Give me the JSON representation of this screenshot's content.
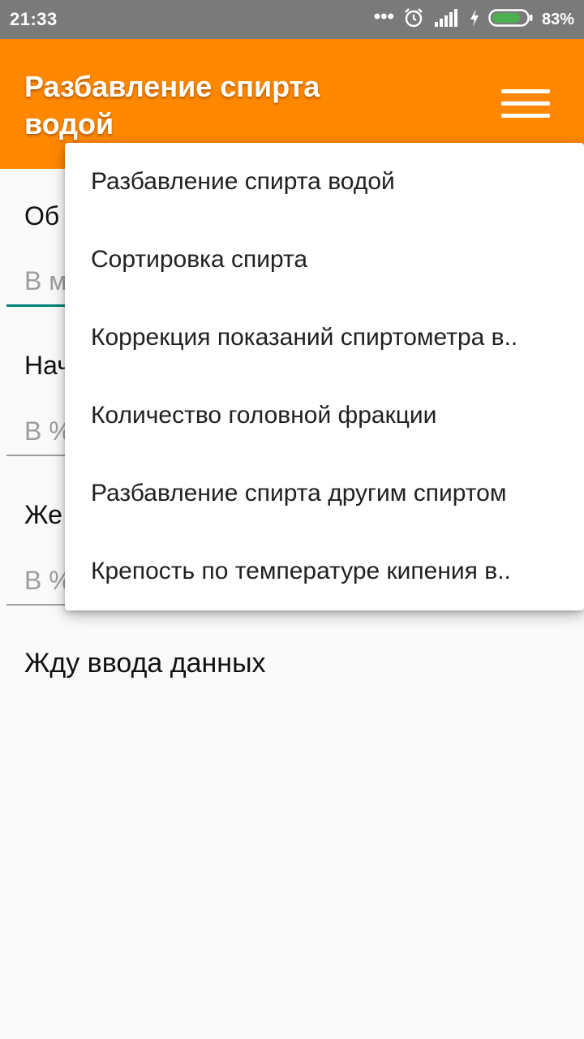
{
  "status_bar": {
    "time": "21:33",
    "battery_percent": "83%",
    "battery_level": 0.83,
    "battery_color": "#4caf50",
    "icons": [
      "more-dots-icon",
      "alarm-icon",
      "signal-icon",
      "charging-icon",
      "battery-icon"
    ]
  },
  "app_bar": {
    "title": "Разбавление спирта водой",
    "color": "#ff8800",
    "menu_icon": "hamburger-menu-icon"
  },
  "form": {
    "fields": [
      {
        "label": "Об",
        "placeholder": "В м"
      },
      {
        "label": "Нач",
        "placeholder": "В %"
      },
      {
        "label": "Же",
        "placeholder": "В %"
      }
    ],
    "focused_field_color": "#008577",
    "result": "Жду ввода данных"
  },
  "menu": {
    "items": [
      "Разбавление спирта водой",
      "Сортировка спирта",
      "Коррекция показаний спиртометра в..",
      "Количество головной фракции",
      "Разбавление спирта другим спиртом",
      "Крепость по температуре кипения в.."
    ]
  }
}
